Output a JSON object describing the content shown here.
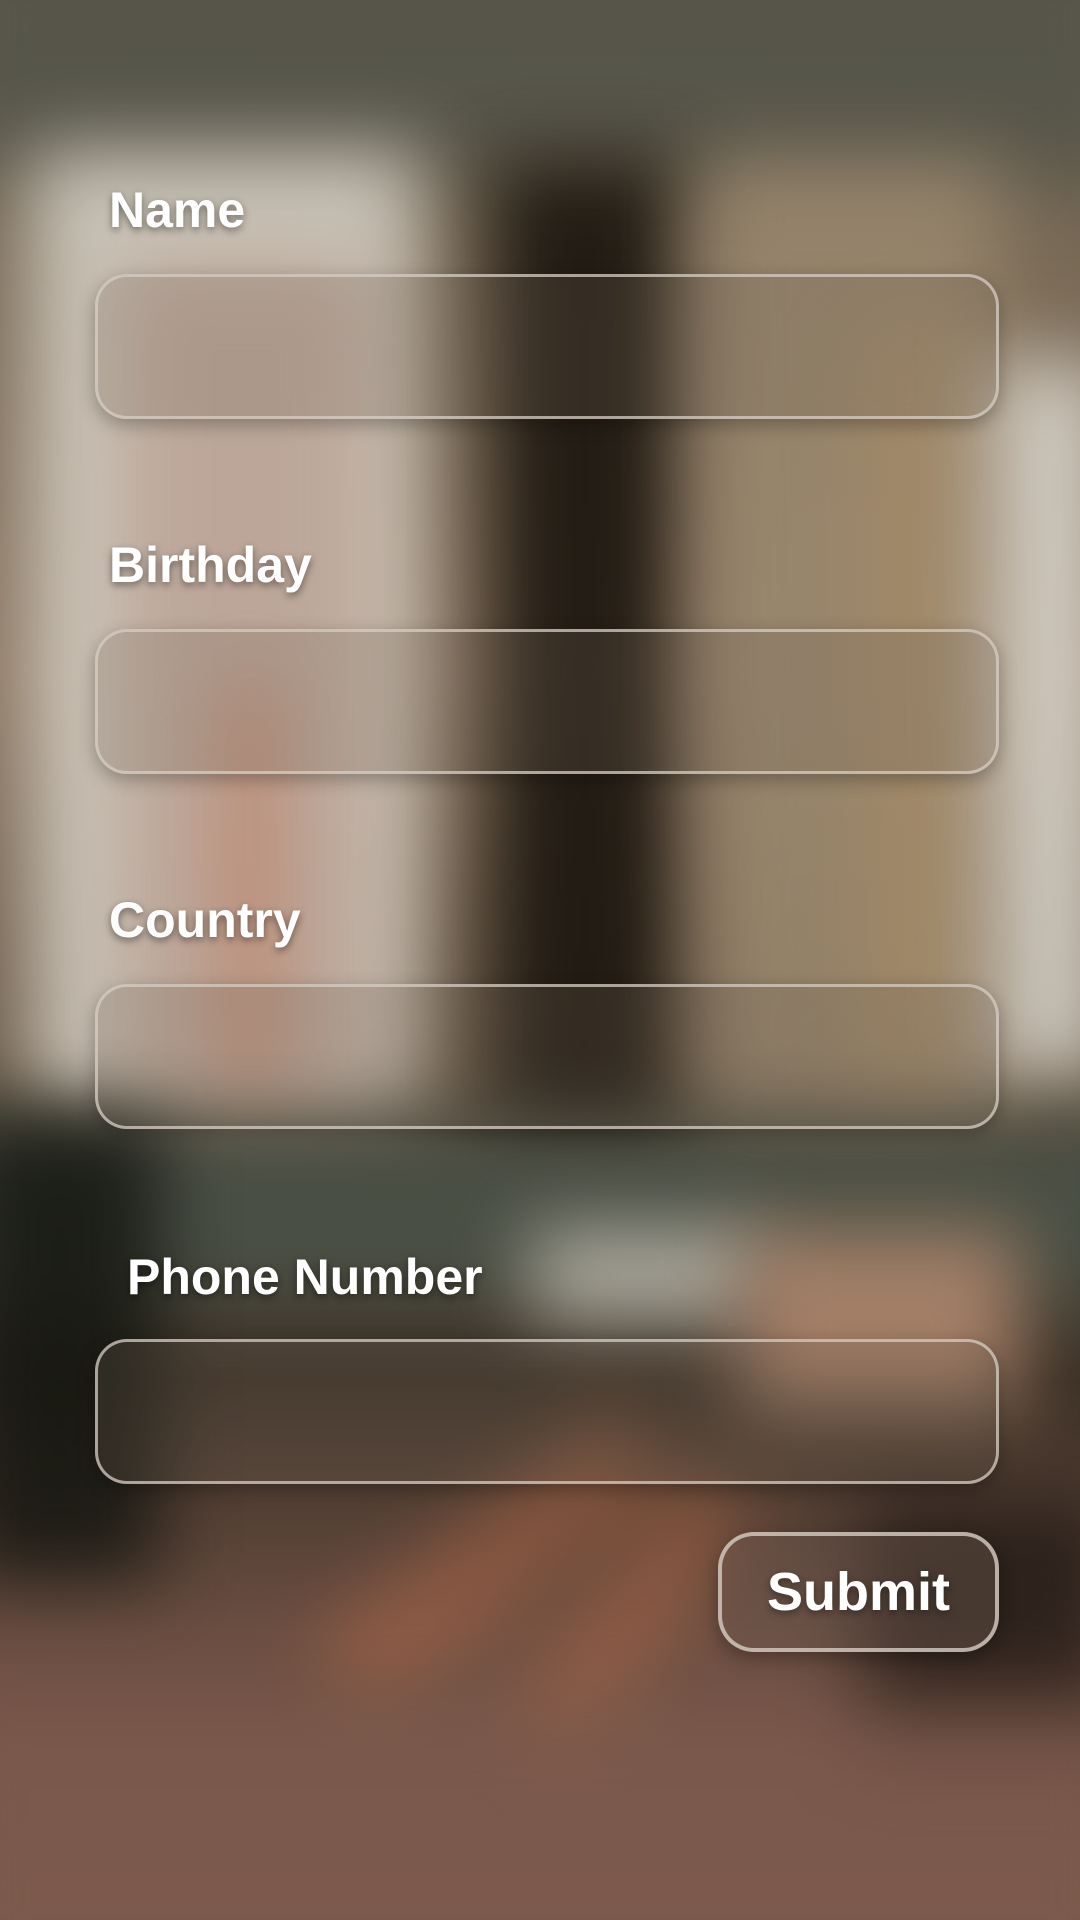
{
  "form": {
    "fields": [
      {
        "label": "Name",
        "value": "",
        "placeholder": ""
      },
      {
        "label": "Birthday",
        "value": "",
        "placeholder": ""
      },
      {
        "label": "Country",
        "value": "",
        "placeholder": ""
      },
      {
        "label": "Phone Number",
        "value": "",
        "placeholder": ""
      }
    ],
    "submit_label": "Submit"
  }
}
